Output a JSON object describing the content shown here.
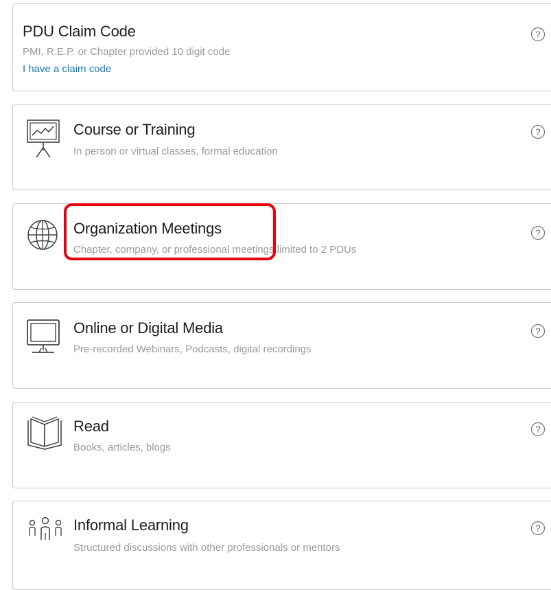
{
  "cards": [
    {
      "title": "PDU Claim Code",
      "description": "PMI, R.E.P. or Chapter provided 10 digit code",
      "link": "I have a claim code"
    },
    {
      "title": "Course or Training",
      "description": "In person or virtual classes, formal education",
      "icon": "presentation-board-icon"
    },
    {
      "title": "Organization Meetings",
      "description": "Chapter, company, or professional meetings limited to 2 PDUs",
      "icon": "globe-icon"
    },
    {
      "title": "Online or Digital Media",
      "description": "Pre-recorded Webinars, Podcasts, digital recordings",
      "icon": "monitor-icon"
    },
    {
      "title": "Read",
      "description": "Books, articles, blogs",
      "icon": "open-book-icon"
    },
    {
      "title": "Informal Learning",
      "description": "Structured discussions with other professionals or mentors",
      "icon": "people-group-icon"
    }
  ],
  "help_icon": "question-circle-icon",
  "colors": {
    "link": "#1479b8",
    "highlight": "#e8000b",
    "border": "#c9c9c9",
    "muted_text": "#9a9a9a"
  }
}
